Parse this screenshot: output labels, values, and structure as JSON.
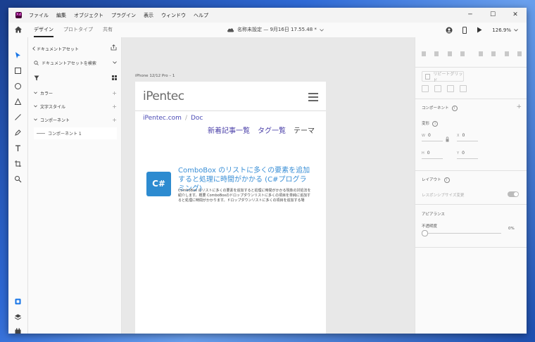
{
  "menu": {
    "app_badge": "Xd",
    "items": [
      "ファイル",
      "編集",
      "オブジェクト",
      "プラグイン",
      "表示",
      "ウィンドウ",
      "ヘルプ"
    ]
  },
  "window_controls": {
    "minimize": "─",
    "maximize": "☐",
    "close": "✕"
  },
  "toolbar": {
    "tabs": [
      "デザイン",
      "プロトタイプ",
      "共有"
    ],
    "active_tab": "デザイン",
    "doc_title": "名称未設定 — 9月16日 17.55.48 *",
    "zoom": "126.9%"
  },
  "left_panel": {
    "title": "ドキュメントアセット",
    "search_placeholder": "ドキュメントアセットを検索",
    "sections": [
      "カラー",
      "文字スタイル",
      "コンポーネント"
    ],
    "component_item": "コンポーネント 1"
  },
  "canvas": {
    "artboard_label": "iPhone 12/12 Pro – 1",
    "logo": "iPentec",
    "breadcrumb": [
      "iPentec.com",
      "Doc"
    ],
    "breadcrumb_sep": "/",
    "nav": [
      "新着記事一覧",
      "タグ一覧",
      "テーマ"
    ],
    "article": {
      "icon_text": "C#",
      "title": "ComboBox のリストに多くの要素を追加すると処理に時間がかかる (C#プログラミング)",
      "description": "ComboBox のリストに多くの要素を追加すると処理に時間がかかる現象の対処法を紹介します。概要 ComboBoxのドロップダウンリストに多くの項目を単純に追加すると処理に時間がかかります。ドロップダウンリストに多くの項目を追加する場"
    }
  },
  "right_panel": {
    "repeat_grid": "リピートグリッド",
    "component_label": "コンポーネント",
    "transform_label": "変形",
    "w_label": "W",
    "w_value": "0",
    "x_label": "X",
    "x_value": "0",
    "h_label": "H",
    "h_value": "0",
    "y_label": "Y",
    "y_value": "0",
    "layout_label": "レイアウト",
    "responsive_label": "レスポンシブサイズ変更",
    "appearance_label": "アピアランス",
    "opacity_label": "不透明度",
    "opacity_value": "0%"
  }
}
